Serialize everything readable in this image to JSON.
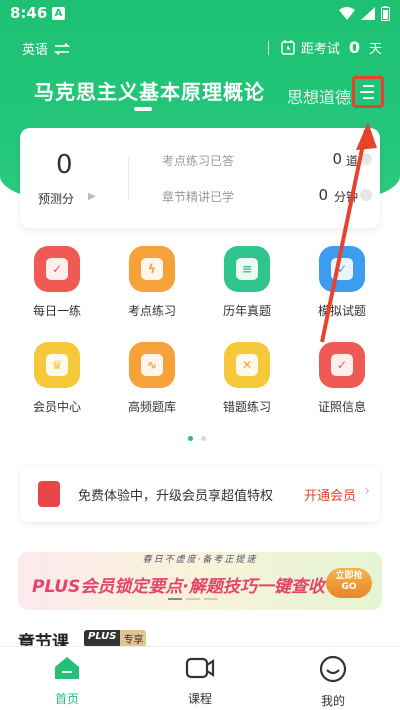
{
  "status_bar": {
    "time": "8:46",
    "notif": "A"
  },
  "top_bar": {
    "language": "英语",
    "exam_label": "距考试",
    "exam_days": "0",
    "exam_unit": "天"
  },
  "subject_tabs": {
    "active": "马克思主义基本原理概论",
    "other": "思想道德"
  },
  "stats": {
    "score_value": "0",
    "score_label": "预测分",
    "practice_label": "考点练习已答",
    "practice_value": "0",
    "practice_unit": "道",
    "chapter_label": "章节精讲已学",
    "chapter_value": "0",
    "chapter_unit": "分钟"
  },
  "features": [
    {
      "label": "每日一练",
      "color": "#f05a55",
      "icon": "calendar-icon"
    },
    {
      "label": "考点练习",
      "color": "#f5a23a",
      "icon": "lightning-icon"
    },
    {
      "label": "历年真题",
      "color": "#2fc58c",
      "icon": "document-icon"
    },
    {
      "label": "模拟试题",
      "color": "#3b9cf0",
      "icon": "checklist-icon"
    },
    {
      "label": "会员中心",
      "color": "#f5c93a",
      "icon": "crown-icon"
    },
    {
      "label": "高频题库",
      "color": "#f5a23a",
      "icon": "pulse-icon"
    },
    {
      "label": "错题练习",
      "color": "#f5c93a",
      "icon": "x-mark-icon"
    },
    {
      "label": "证照信息",
      "color": "#f05a55",
      "icon": "shield-check-icon"
    }
  ],
  "vip_bar": {
    "text": "免费体验中，升级会员享超值特权",
    "link": "开通会员"
  },
  "banner": {
    "top_text": "春日不虚度·备考正提速",
    "main_text": "PLUS会员锁定要点·解题技巧一键查收",
    "button_line1": "立即抢",
    "button_line2": "GO"
  },
  "section": {
    "title": "章节课",
    "badge_plus": "PLUS",
    "badge_text": "专享"
  },
  "bottom_nav": {
    "home": "首页",
    "course": "课程",
    "mine": "我的"
  },
  "colors": {
    "brand": "#23c176",
    "annotation": "#e8412c"
  }
}
